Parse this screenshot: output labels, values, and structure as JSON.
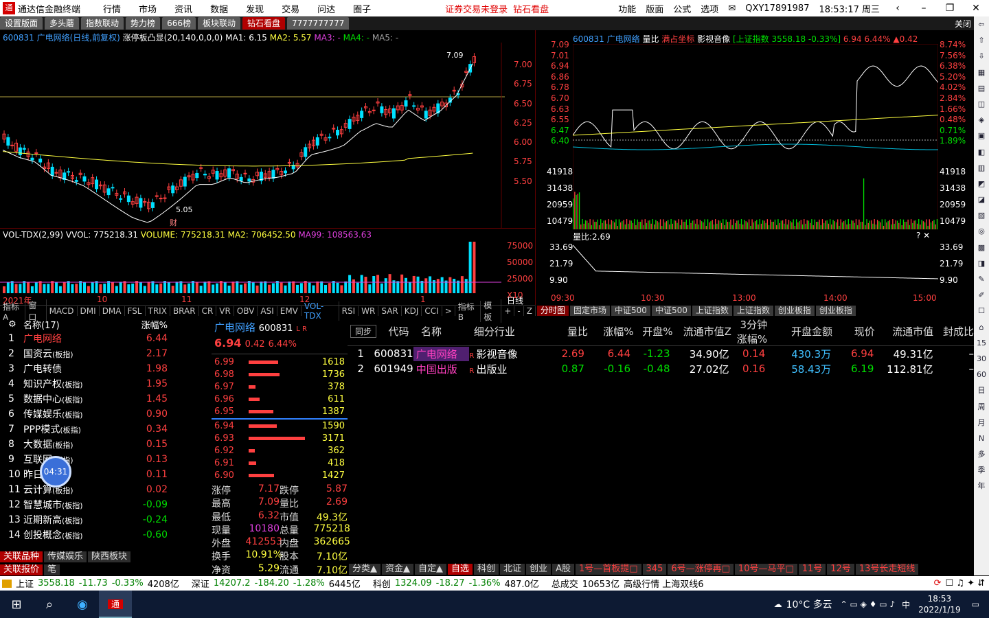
{
  "app": {
    "title": "通达信金融终端",
    "menu": [
      "行情",
      "市场",
      "资讯",
      "数据",
      "发现",
      "交易",
      "问达",
      "圈子"
    ],
    "warning": "证券交易未登录",
    "diamond": "钻石看盘",
    "right_menu": [
      "功能",
      "版面",
      "公式",
      "选项"
    ],
    "user": "QXY17891987",
    "clock": "18:53:17 周三"
  },
  "tabs": [
    "设置版面",
    "多头蘑",
    "指数联动",
    "势力榜",
    "666榜",
    "板块联动",
    "钻石看盘",
    "7777777777"
  ],
  "close_label": "关闭",
  "kline": {
    "header": "600831 广电网络(日线,前复权)",
    "ind": "涨停板凸显(20,140,0,0,0)",
    "ma1": "MA1: 6.15",
    "ma2": "MA2: 5.57",
    "ma3": "MA3: -",
    "ma4": "MA4: -",
    "ma5": "MA5: -",
    "high_label": "7.09",
    "low_label": "5.05",
    "fin": "财",
    "price_ticks": [
      "7.00",
      "6.75",
      "6.50",
      "6.25",
      "6.00",
      "5.75",
      "5.50"
    ],
    "vol_header": "VOL-TDX(2,99)",
    "vvol": "VVOL: 775218.31",
    "volume": "VOLUME: 775218.31",
    "vma2": "MA2: 706452.50",
    "vma99": "MA99: 108563.63",
    "vol_ticks": [
      "75000",
      "50000",
      "25000",
      "X10"
    ],
    "xlabels": [
      "2021年",
      "10",
      "11",
      "12",
      "1"
    ],
    "period": "日线"
  },
  "intraday": {
    "header": "600831 广电网络",
    "lb": "量比",
    "tab2": "满占坐标",
    "sector": "影视音像",
    "index": "[上证指数 3558.18 -0.33%]",
    "price": "6.94",
    "pct": "6.44%",
    "chg": "▲0.42",
    "left_ticks": [
      "7.09",
      "7.01",
      "6.94",
      "6.86",
      "6.78",
      "6.70",
      "6.63",
      "6.55",
      "6.47",
      "6.40"
    ],
    "right_ticks": [
      "8.74%",
      "7.56%",
      "6.38%",
      "5.20%",
      "4.02%",
      "2.84%",
      "1.66%",
      "0.48%",
      "0.71%",
      "1.89%"
    ],
    "vol_ticks": [
      "41918",
      "31438",
      "20959",
      "10479"
    ],
    "ratio_label": "量比:2.69",
    "ratio_ticks": [
      "33.69",
      "21.79",
      "9.90"
    ],
    "times": [
      "09:30",
      "10:30",
      "13:00",
      "14:00",
      "15:00"
    ]
  },
  "indicators": [
    "指标A",
    "窗口",
    "MACD",
    "DMI",
    "DMA",
    "FSL",
    "TRIX",
    "BRAR",
    "CR",
    "VR",
    "OBV",
    "ASI",
    "EMV",
    "VOL-TDX",
    "RSI",
    "WR",
    "SAR",
    "KDJ",
    "CCI",
    ">",
    "指标B",
    "模板",
    "+",
    "-",
    "Z"
  ],
  "subtabs": [
    "分时图",
    "固定市场",
    "中证500",
    "中证500",
    "上证指数",
    "上证指数",
    "创业板指",
    "创业板指"
  ],
  "list": {
    "h_name": "名称(17)",
    "h_pct": "涨幅%",
    "rows": [
      {
        "n": "1",
        "name": "广电网络",
        "tag": "",
        "pct": "6.44"
      },
      {
        "n": "2",
        "name": "国资云",
        "tag": "(板指)",
        "pct": "2.17"
      },
      {
        "n": "3",
        "name": "广电转债",
        "tag": "",
        "pct": "1.98"
      },
      {
        "n": "4",
        "name": "知识产权",
        "tag": "(板指)",
        "pct": "1.95"
      },
      {
        "n": "5",
        "name": "数据中心",
        "tag": "(板指)",
        "pct": "1.45"
      },
      {
        "n": "6",
        "name": "传媒娱乐",
        "tag": "(板指)",
        "pct": "0.90"
      },
      {
        "n": "7",
        "name": "PPP模式",
        "tag": "(板指)",
        "pct": "0.34"
      },
      {
        "n": "8",
        "name": "大数据",
        "tag": "(板指)",
        "pct": "0.15"
      },
      {
        "n": "9",
        "name": "互联网",
        "tag": "(板指)",
        "pct": "0.13"
      },
      {
        "n": "10",
        "name": "昨日",
        "tag": "(板指)",
        "pct": "0.11"
      },
      {
        "n": "11",
        "name": "云计算",
        "tag": "(板指)",
        "pct": "0.02"
      },
      {
        "n": "12",
        "name": "智慧城市",
        "tag": "(板指)",
        "pct": "-0.09"
      },
      {
        "n": "13",
        "name": "近期新高",
        "tag": "(板指)",
        "pct": "-0.24"
      },
      {
        "n": "14",
        "name": "创投概念",
        "tag": "(板指)",
        "pct": "-0.60"
      }
    ],
    "timer": "04:31",
    "bottom_tabs": [
      "关联品种",
      "传媒娱乐",
      "陕西板块"
    ],
    "bottom2": [
      "关联报价",
      "笔"
    ]
  },
  "quote": {
    "name": "广电网络",
    "code": "600831",
    "price": "6.94",
    "chg": "0.42",
    "pct": "6.44%",
    "asks": [
      {
        "p": "6.99",
        "v": "1618",
        "w": 52
      },
      {
        "p": "6.98",
        "v": "1736",
        "w": 55
      },
      {
        "p": "6.97",
        "v": "378",
        "w": 12
      },
      {
        "p": "6.96",
        "v": "611",
        "w": 19
      },
      {
        "p": "6.95",
        "v": "1387",
        "w": 44
      }
    ],
    "bids": [
      {
        "p": "6.94",
        "v": "1590",
        "w": 50
      },
      {
        "p": "6.93",
        "v": "3171",
        "w": 100
      },
      {
        "p": "6.92",
        "v": "362",
        "w": 11
      },
      {
        "p": "6.91",
        "v": "418",
        "w": 13
      },
      {
        "p": "6.90",
        "v": "1427",
        "w": 45
      }
    ],
    "stats": [
      [
        "涨停",
        "7.17",
        "跌停",
        "5.87"
      ],
      [
        "最高",
        "7.09",
        "量比",
        "2.69"
      ],
      [
        "最低",
        "6.32",
        "市值",
        "49.3亿"
      ],
      [
        "现量",
        "10180",
        "总量",
        "775218"
      ],
      [
        "外盘",
        "412553",
        "内盘",
        "362665"
      ],
      [
        "换手",
        "10.91%",
        "股本",
        "7.10亿"
      ],
      [
        "净资",
        "5.29",
        "流通",
        "7.10亿"
      ]
    ]
  },
  "table": {
    "sync": "同步",
    "headers": [
      "代码",
      "名称",
      "细分行业",
      "量比",
      "涨幅%",
      "开盘%",
      "流通市值Z",
      "3分钟涨幅%",
      "开盘金额",
      "现价",
      "流通市值",
      "封成比"
    ],
    "rows": [
      [
        "1",
        "600831",
        "广电网络",
        "影视音像",
        "2.69",
        "6.44",
        "-1.23",
        "34.90亿",
        "0.14",
        "430.3万",
        "6.94",
        "49.31亿",
        "–"
      ],
      [
        "2",
        "601949",
        "中国出版",
        "出版业",
        "0.87",
        "-0.16",
        "-0.48",
        "27.02亿",
        "0.16",
        "58.43万",
        "6.19",
        "112.81亿",
        "–"
      ]
    ]
  },
  "bottom_tabs": [
    "分类▲",
    "资金▲",
    "自定▲",
    "自选",
    "科创",
    "北证",
    "创业",
    "A股",
    "1号—首板提□",
    "345",
    "6号—涨停再□",
    "10号—马平□",
    "11号",
    "12号",
    "13号长走短线"
  ],
  "status": {
    "sh": "上证",
    "sh_v": "3558.18",
    "sh_c": "-11.73",
    "sh_p": "-0.33%",
    "sh_a": "4208亿",
    "sz": "深证",
    "sz_v": "14207.2",
    "sz_c": "-184.20",
    "sz_p": "-1.28%",
    "sz_a": "6445亿",
    "kc": "科创",
    "kc_v": "1324.09",
    "kc_c": "-18.27",
    "kc_p": "-1.36%",
    "kc_a": "487.0亿",
    "total": "总成交",
    "total_v": "10653亿",
    "feed": "高级行情 上海双线6"
  },
  "taskbar": {
    "weather": "10°C 多云",
    "ime": "中",
    "time": "18:53",
    "date": "2022/1/19"
  },
  "sidebar": [
    "15",
    "30",
    "60",
    "日",
    "周",
    "月",
    "N",
    "多",
    "季",
    "年"
  ],
  "colors": {
    "up": "#ff4040",
    "down": "#00e0ff",
    "ma1": "#ffffff",
    "ma2": "#ffff40"
  }
}
